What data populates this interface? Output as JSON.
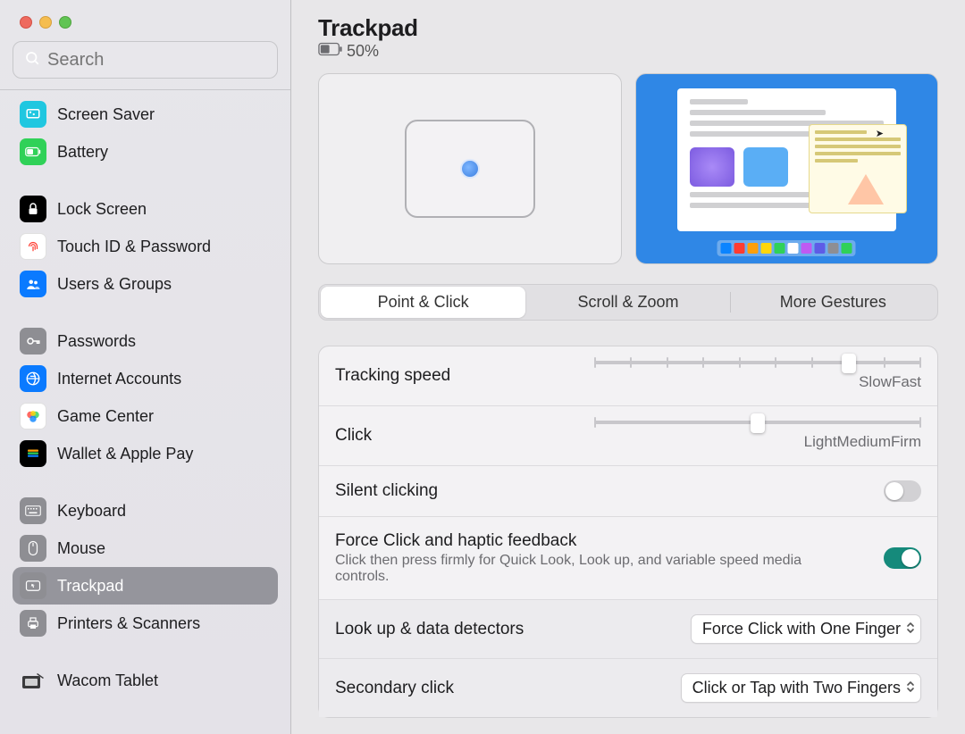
{
  "search": {
    "placeholder": "Search"
  },
  "sidebar": {
    "groups": [
      {
        "items": [
          {
            "id": "screen-saver",
            "label": "Screen Saver",
            "icon": "screensaver"
          },
          {
            "id": "battery",
            "label": "Battery",
            "icon": "battery"
          }
        ]
      },
      {
        "items": [
          {
            "id": "lock-screen",
            "label": "Lock Screen",
            "icon": "lock"
          },
          {
            "id": "touch-id",
            "label": "Touch ID & Password",
            "icon": "touchid"
          },
          {
            "id": "users-groups",
            "label": "Users & Groups",
            "icon": "users"
          }
        ]
      },
      {
        "items": [
          {
            "id": "passwords",
            "label": "Passwords",
            "icon": "passwords"
          },
          {
            "id": "internet-accounts",
            "label": "Internet Accounts",
            "icon": "internet"
          },
          {
            "id": "game-center",
            "label": "Game Center",
            "icon": "gamecenter"
          },
          {
            "id": "wallet",
            "label": "Wallet & Apple Pay",
            "icon": "wallet"
          }
        ]
      },
      {
        "items": [
          {
            "id": "keyboard",
            "label": "Keyboard",
            "icon": "keyboard"
          },
          {
            "id": "mouse",
            "label": "Mouse",
            "icon": "mouse"
          },
          {
            "id": "trackpad",
            "label": "Trackpad",
            "icon": "trackpad",
            "active": true
          },
          {
            "id": "printers",
            "label": "Printers & Scanners",
            "icon": "printers"
          }
        ]
      },
      {
        "items": [
          {
            "id": "wacom",
            "label": "Wacom Tablet",
            "icon": "wacom"
          }
        ]
      }
    ]
  },
  "main": {
    "title": "Trackpad",
    "battery_percent": "50%",
    "tabs": [
      {
        "id": "point-click",
        "label": "Point & Click",
        "active": true
      },
      {
        "id": "scroll-zoom",
        "label": "Scroll & Zoom"
      },
      {
        "id": "more-gestures",
        "label": "More Gestures"
      }
    ],
    "tracking_speed": {
      "label": "Tracking speed",
      "ticks": 10,
      "value_index": 7,
      "min_label": "Slow",
      "max_label": "Fast"
    },
    "click": {
      "label": "Click",
      "ticks": 3,
      "value_index": 1,
      "labels": [
        "Light",
        "Medium",
        "Firm"
      ]
    },
    "silent_clicking": {
      "label": "Silent clicking",
      "on": false
    },
    "force_click": {
      "label": "Force Click and haptic feedback",
      "sub": "Click then press firmly for Quick Look, Look up, and variable speed media controls.",
      "on": true
    },
    "lookup": {
      "label": "Look up & data detectors",
      "value": "Force Click with One Finger"
    },
    "secondary": {
      "label": "Secondary click",
      "value": "Click or Tap with Two Fingers"
    }
  },
  "colors": {
    "dock": [
      "#0a84ff",
      "#ff3b30",
      "#ff9f0a",
      "#ffd60a",
      "#30d158",
      "#ffffff",
      "#bf5af2",
      "#5e5ce6",
      "#8e8e93",
      "#30d158"
    ]
  }
}
